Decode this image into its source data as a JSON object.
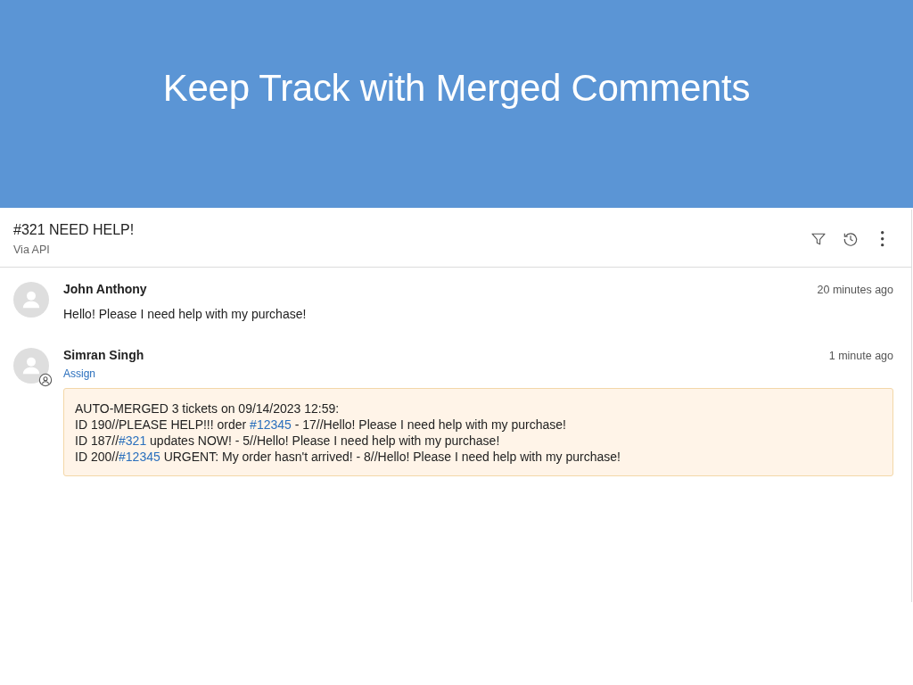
{
  "banner": {
    "title": "Keep Track with Merged Comments"
  },
  "ticket": {
    "title": "#321 NEED HELP!",
    "source": "Via API"
  },
  "comments": [
    {
      "author": "John Anthony",
      "time": "20 minutes ago",
      "kind": "message",
      "body": "Hello! Please I need help with my purchase!"
    },
    {
      "author": "Simran Singh",
      "time": "1 minute ago",
      "kind": "merge",
      "assign": "Assign",
      "note": [
        [
          {
            "kind": "text",
            "text": "AUTO-MERGED 3 tickets on 09/14/2023 12:59:"
          }
        ],
        [
          {
            "kind": "text",
            "text": "ID 190//PLEASE HELP!!! order "
          },
          {
            "kind": "link",
            "text": "#12345"
          },
          {
            "kind": "text",
            "text": " - 17//Hello! Please I need help with my purchase!"
          }
        ],
        [
          {
            "kind": "text",
            "text": "ID 187//"
          },
          {
            "kind": "link",
            "text": "#321"
          },
          {
            "kind": "text",
            "text": " updates NOW! - 5//Hello! Please I need help with my purchase!"
          }
        ],
        [
          {
            "kind": "text",
            "text": "ID 200//"
          },
          {
            "kind": "link",
            "text": "#12345"
          },
          {
            "kind": "text",
            "text": " URGENT: My order hasn't arrived! - 8//Hello! Please I need help with my purchase!"
          }
        ]
      ]
    }
  ]
}
